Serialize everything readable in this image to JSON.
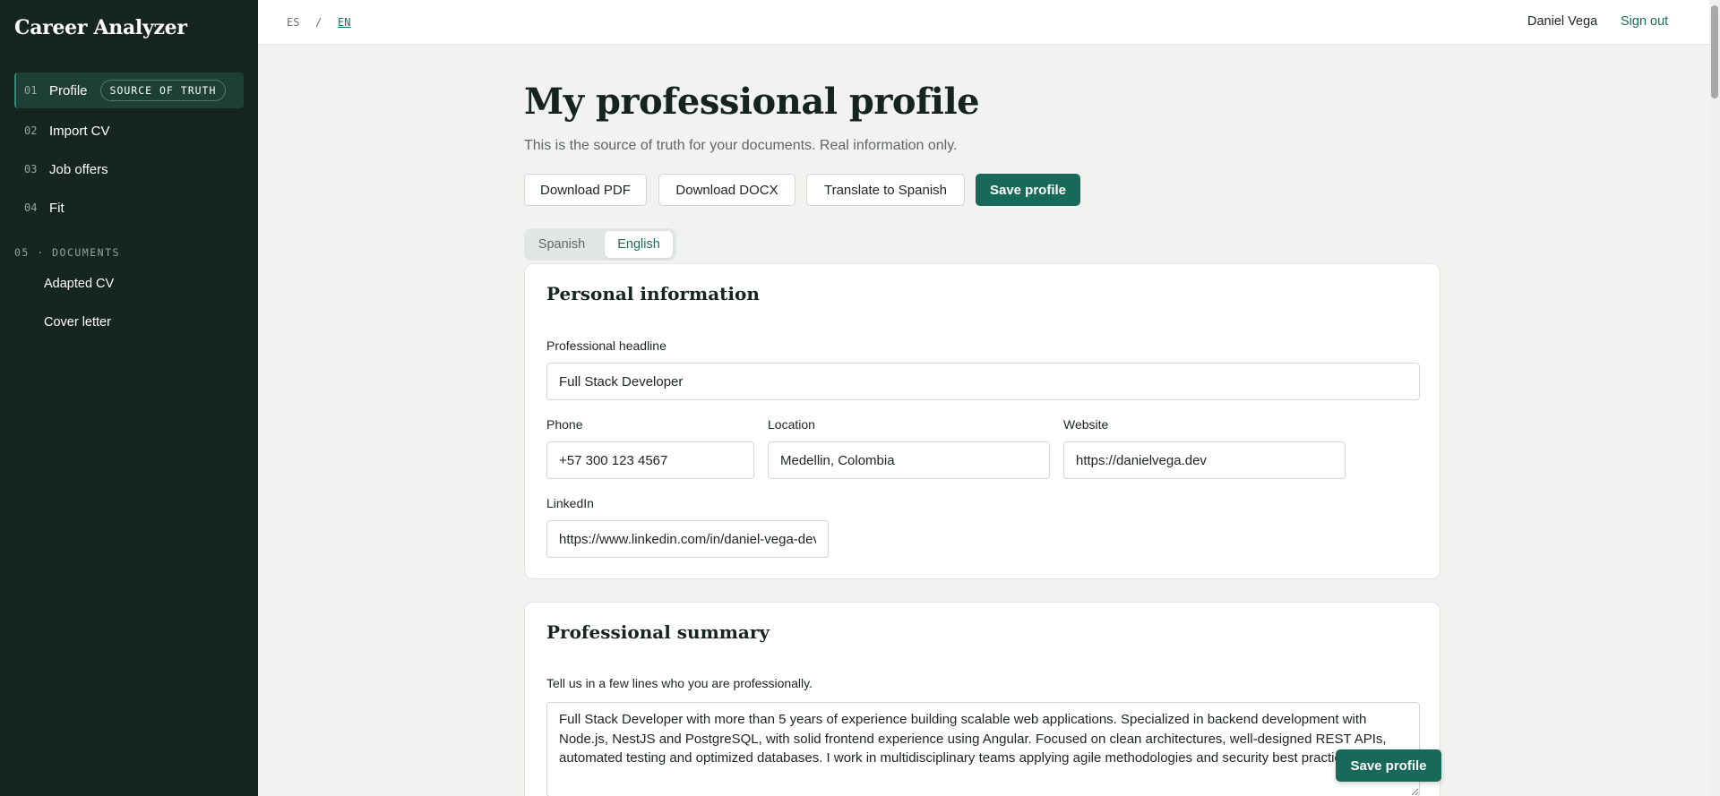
{
  "app": {
    "name": "Career Analyzer"
  },
  "sidebar": {
    "items": [
      {
        "num": "01",
        "label": "Profile",
        "badge": "SOURCE OF TRUTH"
      },
      {
        "num": "02",
        "label": "Import CV"
      },
      {
        "num": "03",
        "label": "Job offers"
      },
      {
        "num": "04",
        "label": "Fit"
      }
    ],
    "documents_section": "05 · DOCUMENTS",
    "documents": [
      "Adapted CV",
      "Cover letter"
    ]
  },
  "topbar": {
    "lang_es": "ES",
    "lang_sep": "/",
    "lang_en": "EN",
    "active_lang": "EN",
    "user_name": "Daniel Vega",
    "sign_out": "Sign out"
  },
  "main": {
    "title": "My professional profile",
    "subtitle": "This is the source of truth for your documents. Real information only.",
    "actions": {
      "download_pdf": "Download PDF",
      "download_docx": "Download DOCX",
      "translate": "Translate to Spanish",
      "save": "Save profile"
    },
    "tabs": [
      "Spanish",
      "English"
    ],
    "active_tab": "English"
  },
  "personal": {
    "title": "Personal information",
    "headline_label": "Professional headline",
    "headline_value": "Full Stack Developer",
    "phone_label": "Phone",
    "phone_value": "+57 300 123 4567",
    "location_label": "Location",
    "location_value": "Medellin, Colombia",
    "website_label": "Website",
    "website_value": "https://danielvega.dev",
    "linkedin_label": "LinkedIn",
    "linkedin_value": "https://www.linkedin.com/in/daniel-vega-dev"
  },
  "summary": {
    "title": "Professional summary",
    "prompt": "Tell us in a few lines who you are professionally.",
    "text": "Full Stack Developer with more than 5 years of experience building scalable web applications. Specialized in backend development with Node.js, NestJS and PostgreSQL, with solid frontend experience using Angular. Focused on clean architectures, well-designed REST APIs, automated testing and optimized databases. I work in multidisciplinary teams applying agile methodologies and security best practices."
  },
  "floating_save": "Save profile",
  "colors": {
    "sidebar_bg": "#16261f",
    "accent": "#18695a",
    "page_bg": "#f2f3f1"
  }
}
